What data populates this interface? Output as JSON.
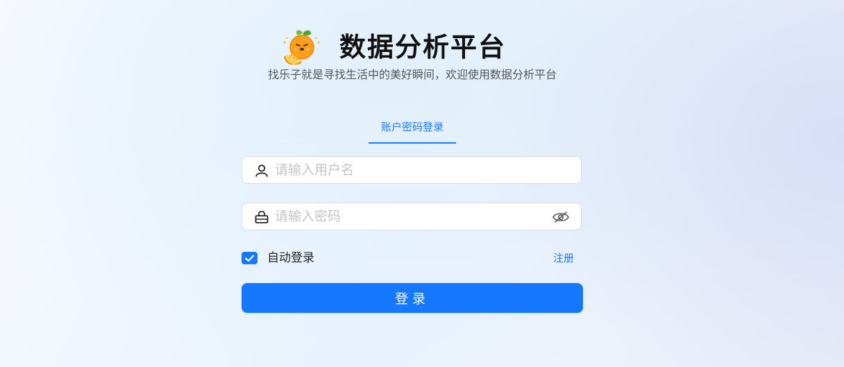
{
  "header": {
    "title": "数据分析平台",
    "subtitle": "找乐子就是寻找生活中的美好瞬间，欢迎使用数据分析平台",
    "logo_icon": "orange-fruit-logo"
  },
  "tabs": [
    {
      "label": "账户密码登录",
      "active": true
    }
  ],
  "form": {
    "username": {
      "placeholder": "请输入用户名",
      "value": "",
      "icon": "user-icon"
    },
    "password": {
      "placeholder": "请输入密码",
      "value": "",
      "icon": "lock-icon",
      "toggle_icon": "eye-hidden-icon"
    },
    "remember": {
      "label": "自动登录",
      "checked": true
    },
    "register_link": "注册",
    "submit_label": "登录"
  },
  "colors": {
    "primary": "#1677ff",
    "title": "#111111",
    "subtitle": "#555555",
    "placeholder": "#c2c4c8",
    "input_border": "#d9dce3"
  }
}
